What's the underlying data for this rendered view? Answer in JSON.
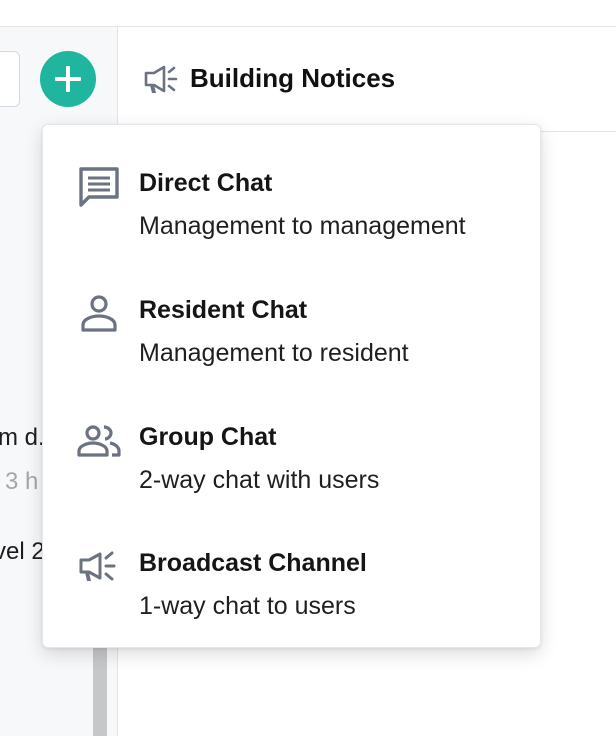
{
  "colors": {
    "accent": "#1fb59f",
    "icon_gray": "#6b7280"
  },
  "header": {
    "title": "Building Notices",
    "icon": "megaphone-icon"
  },
  "sidebar": {
    "add_button_icon": "plus-icon",
    "previews": [
      {
        "text": "m d."
      },
      {
        "text": "3 h"
      },
      {
        "text": "vel 2"
      }
    ]
  },
  "menu": {
    "items": [
      {
        "title": "Direct Chat",
        "subtitle": "Management to management",
        "icon": "chat-bubble-icon"
      },
      {
        "title": "Resident Chat",
        "subtitle": "Management to resident",
        "icon": "person-icon"
      },
      {
        "title": "Group Chat",
        "subtitle": "2-way chat with users",
        "icon": "people-icon"
      },
      {
        "title": "Broadcast Channel",
        "subtitle": "1-way chat to users",
        "icon": "megaphone-icon"
      }
    ]
  }
}
